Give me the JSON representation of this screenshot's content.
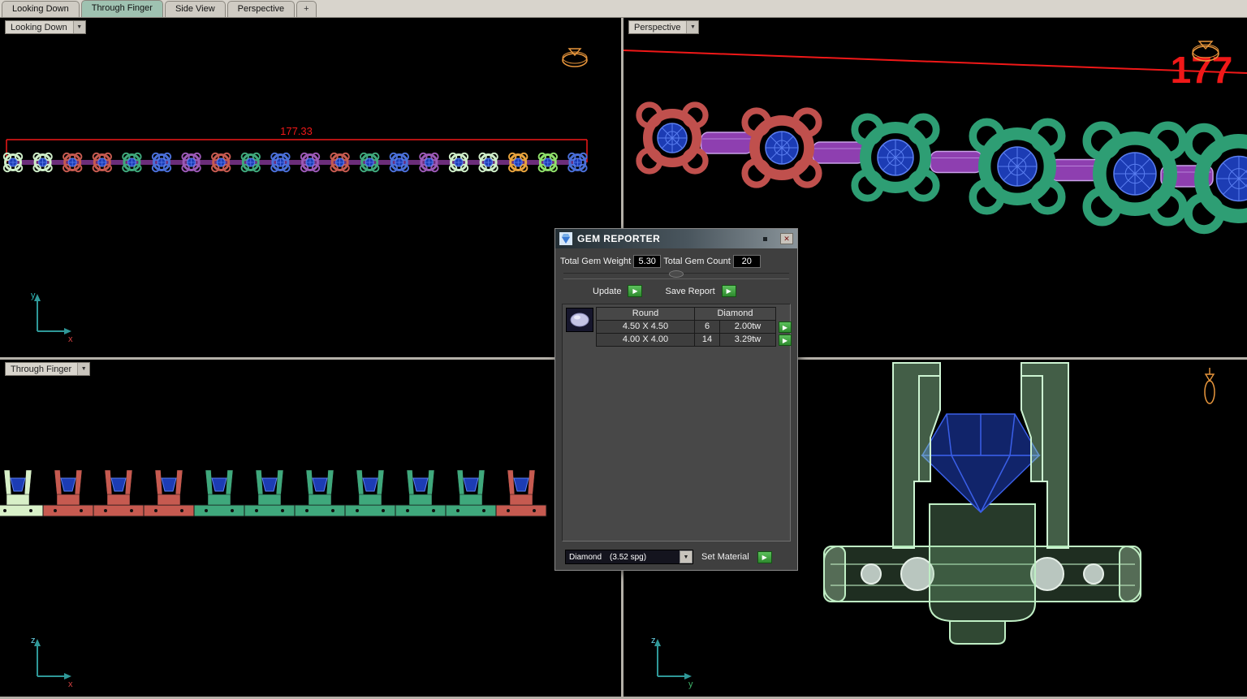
{
  "tabbar": {
    "tabs": [
      {
        "label": "Looking Down"
      },
      {
        "label": "Through Finger"
      },
      {
        "label": "Side View"
      },
      {
        "label": "Perspective"
      },
      {
        "label": "+"
      }
    ],
    "active_tab": "Through Finger"
  },
  "viewports": {
    "looking_down": {
      "label": "Looking Down",
      "dimension_text": "177.33",
      "axis_v": "y",
      "axis_h": "x"
    },
    "perspective": {
      "label": "Perspective",
      "dimension_text": "177"
    },
    "through_finger": {
      "label": "Through Finger",
      "axis_v": "z",
      "axis_h": "x"
    },
    "side_view": {
      "axis_v": "z",
      "axis_h": "y"
    }
  },
  "gem_reporter": {
    "title": "GEM REPORTER",
    "total_gem_weight_label": "Total Gem Weight",
    "total_gem_weight_value": "5.30",
    "total_gem_count_label": "Total Gem Count",
    "total_gem_count_value": "20",
    "update_label": "Update",
    "save_report_label": "Save Report",
    "table": {
      "col_round": "Round",
      "col_diamond": "Diamond",
      "rows": [
        {
          "size": "4.50 X 4.50",
          "count": "6",
          "weight": "2.00tw"
        },
        {
          "size": "4.00 X 4.00",
          "count": "14",
          "weight": "3.29tw"
        }
      ]
    },
    "material_name": "Diamond",
    "material_spg": "(3.52 spg)",
    "set_material_label": "Set Material"
  },
  "scene": {
    "dimension_color": "#f01818",
    "gizmo_color": "#e8963c",
    "gem_fill": "#1c3cb4",
    "gem_line": "#5a7ef0",
    "link_color": "#8e3fb0",
    "setting_color": "#bfeec4",
    "looking_down_chain": [
      "#cfeec9",
      "#cfeec9",
      "#c65a50",
      "#c65a50",
      "#3fa87c",
      "#4a6fd8",
      "#9b59b6",
      "#c65a50",
      "#3fa87c",
      "#4a6fd8",
      "#9b59b6",
      "#c65a50",
      "#3fa87c",
      "#4a6fd8",
      "#9b59b6",
      "#cfeec9",
      "#cfeec9",
      "#e8a33d",
      "#8fe06a",
      "#4a6fd8"
    ],
    "perspective_chain": [
      "#c0504d",
      "#c0504d",
      "#2e9e74",
      "#2e9e74",
      "#2e9e74",
      "#2e9e74"
    ],
    "through_finger_chain": [
      "#d8f0c8",
      "#c65a50",
      "#c65a50",
      "#c65a50",
      "#3fa87c",
      "#3fa87c",
      "#3fa87c",
      "#3fa87c",
      "#3fa87c",
      "#3fa87c",
      "#c65a50"
    ]
  }
}
